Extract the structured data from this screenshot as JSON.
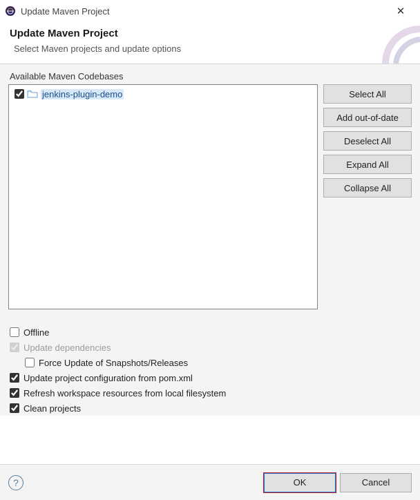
{
  "window": {
    "title": "Update Maven Project"
  },
  "header": {
    "title": "Update Maven Project",
    "description": "Select Maven projects and update options"
  },
  "tree": {
    "section_label": "Available Maven Codebases",
    "items": [
      {
        "label": "jenkins-plugin-demo",
        "checked": true
      }
    ]
  },
  "side_buttons": {
    "select_all": "Select All",
    "add_out_of_date": "Add out-of-date",
    "deselect_all": "Deselect All",
    "expand_all": "Expand All",
    "collapse_all": "Collapse All"
  },
  "options": {
    "offline": {
      "label": "Offline",
      "checked": false,
      "enabled": true
    },
    "update_deps": {
      "label": "Update dependencies",
      "checked": true,
      "enabled": false
    },
    "force_update": {
      "label": "Force Update of Snapshots/Releases",
      "checked": false,
      "enabled": true
    },
    "update_config": {
      "label": "Update project configuration from pom.xml",
      "checked": true,
      "enabled": true
    },
    "refresh_ws": {
      "label": "Refresh workspace resources from local filesystem",
      "checked": true,
      "enabled": true
    },
    "clean": {
      "label": "Clean projects",
      "checked": true,
      "enabled": true
    }
  },
  "footer": {
    "ok": "OK",
    "cancel": "Cancel"
  }
}
